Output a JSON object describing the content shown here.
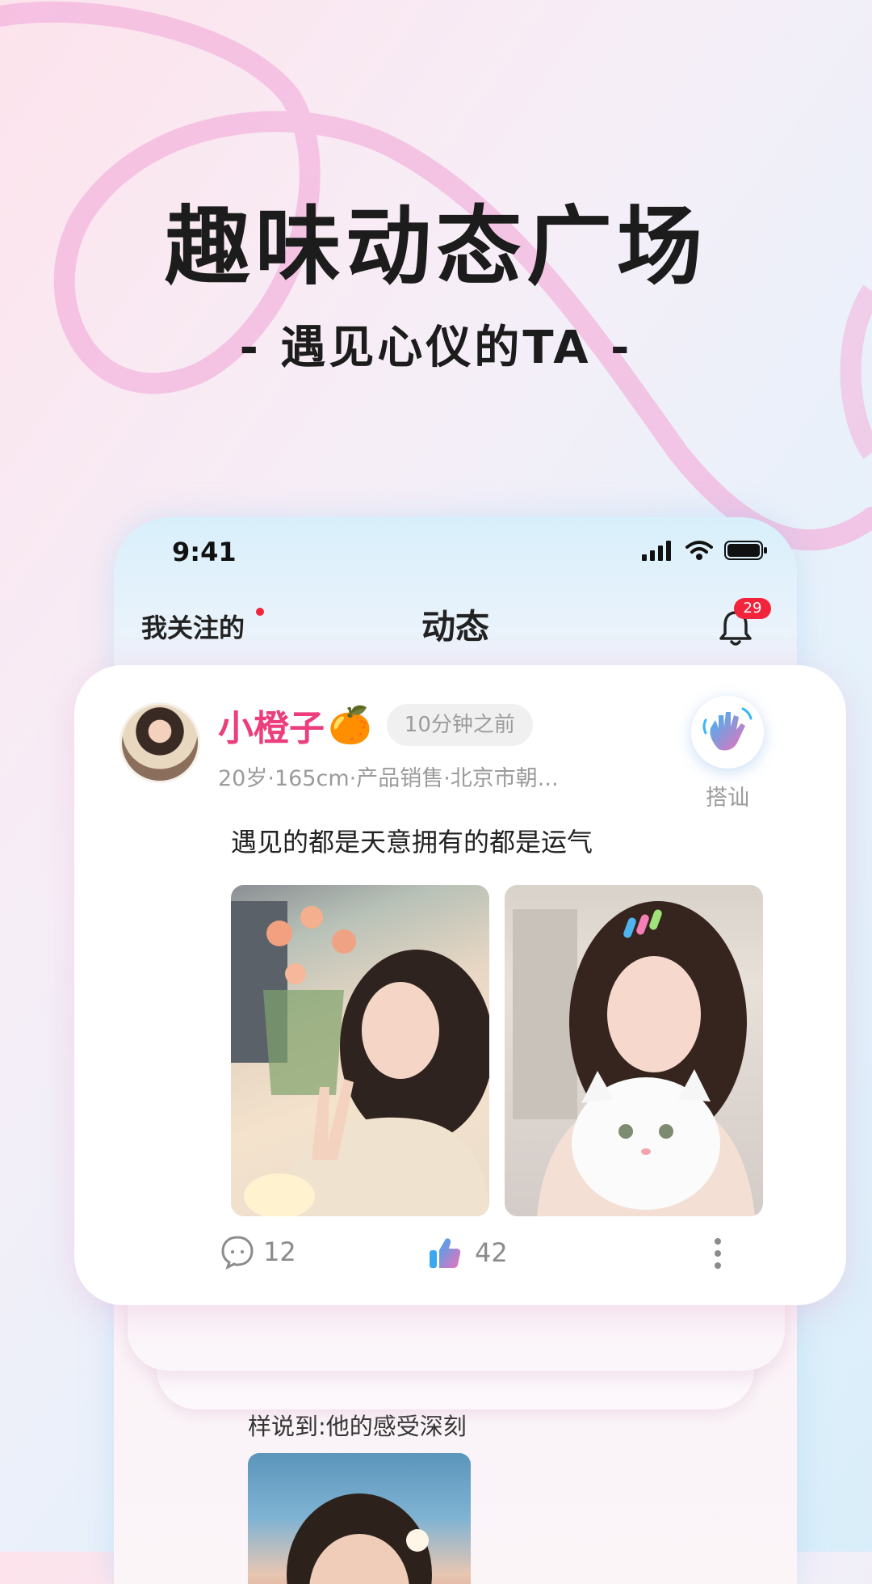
{
  "headline": {
    "title": "趣味动态广场",
    "subtitle": "-  遇见心仪的TA  -"
  },
  "statusbar": {
    "time": "9:41"
  },
  "nav": {
    "left_label": "我关注的",
    "title": "动态",
    "notification_count": "29"
  },
  "post": {
    "username": "小橙子",
    "name_emoji": "🍊",
    "time_ago": "10分钟之前",
    "meta": "20岁·165cm·产品销售·北京市朝...",
    "greet_label": "搭讪",
    "text": "遇见的都是天意拥有的都是运气",
    "comments": "12",
    "likes": "42"
  },
  "next_post": {
    "text": "样说到:他的感受深刻"
  },
  "colors": {
    "accent_pink": "#ec3e7d",
    "badge_red": "#f2243b",
    "loop_pink": "#f3b6dd"
  }
}
